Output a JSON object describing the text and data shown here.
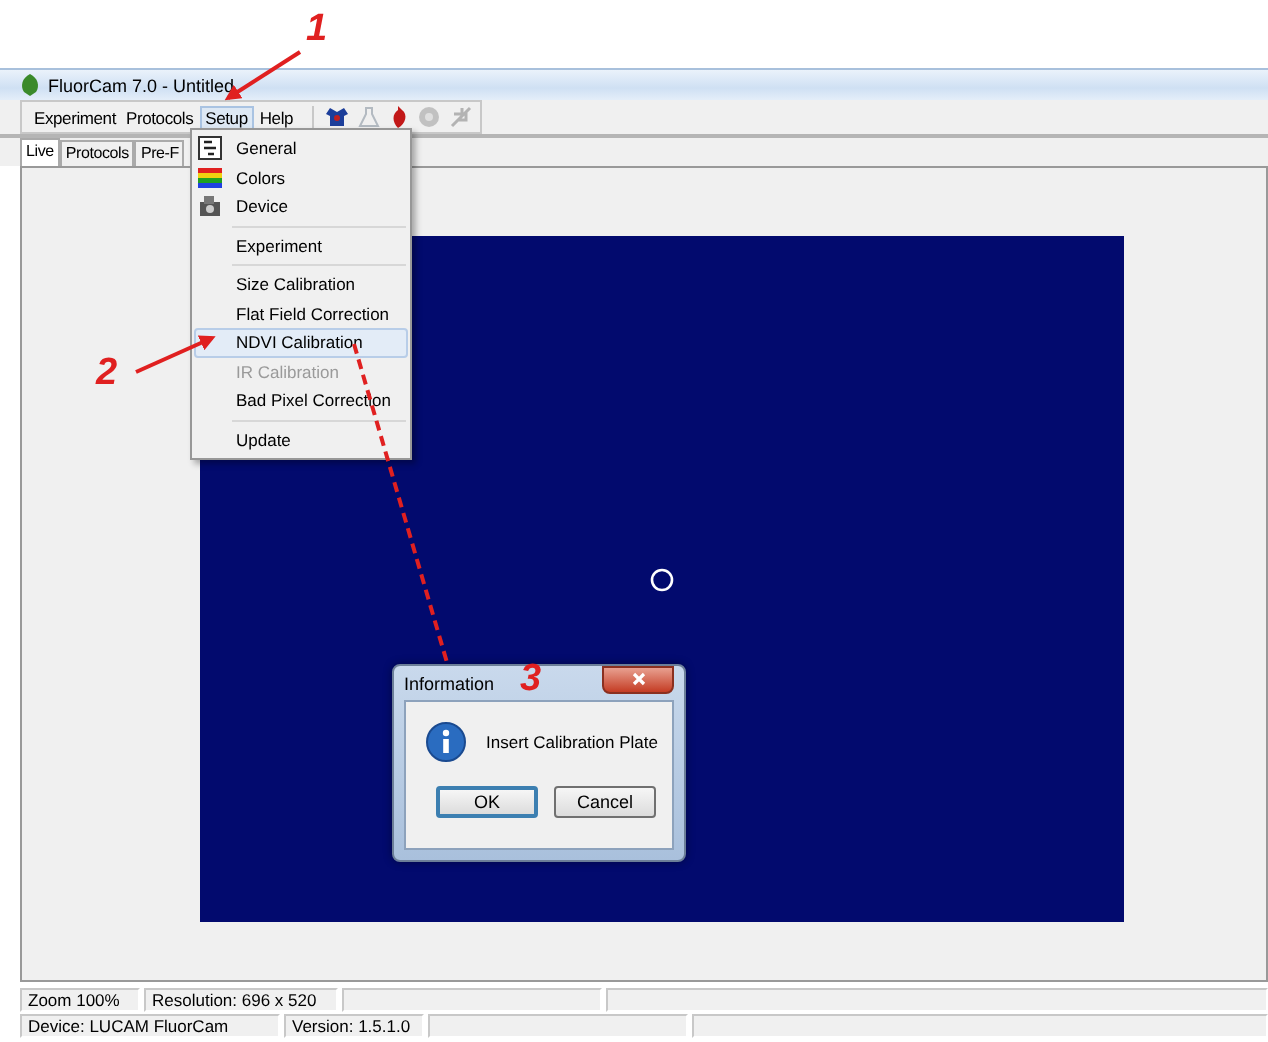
{
  "window": {
    "title": "FluorCam 7.0 - Untitled"
  },
  "menu_bar": [
    {
      "label": "Experiment",
      "selected": false
    },
    {
      "label": "Protocols",
      "selected": false
    },
    {
      "label": "Setup",
      "selected": true
    },
    {
      "label": "Help",
      "selected": false
    }
  ],
  "toolbar": [
    {
      "disabled": false
    },
    {
      "disabled": true
    },
    {
      "disabled": false
    },
    {
      "disabled": true
    },
    {
      "disabled": true
    }
  ],
  "tabs": [
    {
      "label": "Live",
      "selected": true
    },
    {
      "label": "Protocols",
      "selected": false
    },
    {
      "label": "Pre-F",
      "selected": false
    }
  ],
  "setup_menu": {
    "items": [
      {
        "kind": "icon-item",
        "label": "General",
        "selected": false,
        "disabled": false
      },
      {
        "kind": "icon-item",
        "label": "Colors",
        "selected": false,
        "disabled": false
      },
      {
        "kind": "icon-item",
        "label": "Device",
        "selected": false,
        "disabled": false
      },
      {
        "kind": "separator"
      },
      {
        "kind": "item",
        "label": "Experiment",
        "selected": false,
        "disabled": false
      },
      {
        "kind": "separator"
      },
      {
        "kind": "item",
        "label": "Size Calibration",
        "selected": false,
        "disabled": false
      },
      {
        "kind": "item",
        "label": "Flat Field Correction",
        "selected": false,
        "disabled": false
      },
      {
        "kind": "item",
        "label": "NDVI Calibration",
        "selected": true,
        "disabled": false
      },
      {
        "kind": "item",
        "label": "IR Calibration",
        "selected": false,
        "disabled": true
      },
      {
        "kind": "item",
        "label": "Bad Pixel Correction",
        "selected": false,
        "disabled": false
      },
      {
        "kind": "separator"
      },
      {
        "kind": "item",
        "label": "Update",
        "selected": false,
        "disabled": false
      }
    ]
  },
  "dialog": {
    "title": "Information",
    "message": "Insert Calibration Plate",
    "buttons": [
      {
        "label": "OK",
        "default": true
      },
      {
        "label": "Cancel",
        "default": false
      }
    ]
  },
  "status_bar": [
    [
      "Zoom 100%",
      "Resolution: 696 x 520"
    ],
    [
      "Device: LUCAM FluorCam",
      "Version: 1.5.1.0"
    ]
  ],
  "annotations": [
    {
      "label": "1"
    },
    {
      "label": "2"
    },
    {
      "label": "3"
    }
  ]
}
